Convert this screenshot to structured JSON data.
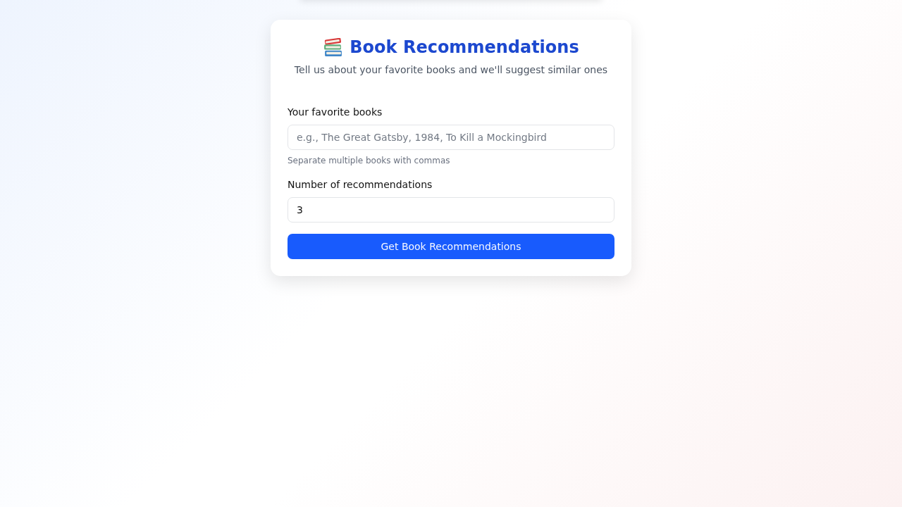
{
  "header": {
    "title": "Book Recommendations",
    "subtitle": "Tell us about your favorite books and we'll suggest similar ones"
  },
  "form": {
    "fields": [
      {
        "label": "Your favorite books",
        "placeholder": "e.g., The Great Gatsby, 1984, To Kill a Mockingbird",
        "hint": "Separate multiple books with commas"
      },
      {
        "label": "Number of recommendations",
        "value": "3"
      }
    ],
    "submit_button": "Get Book Recommendations"
  }
}
